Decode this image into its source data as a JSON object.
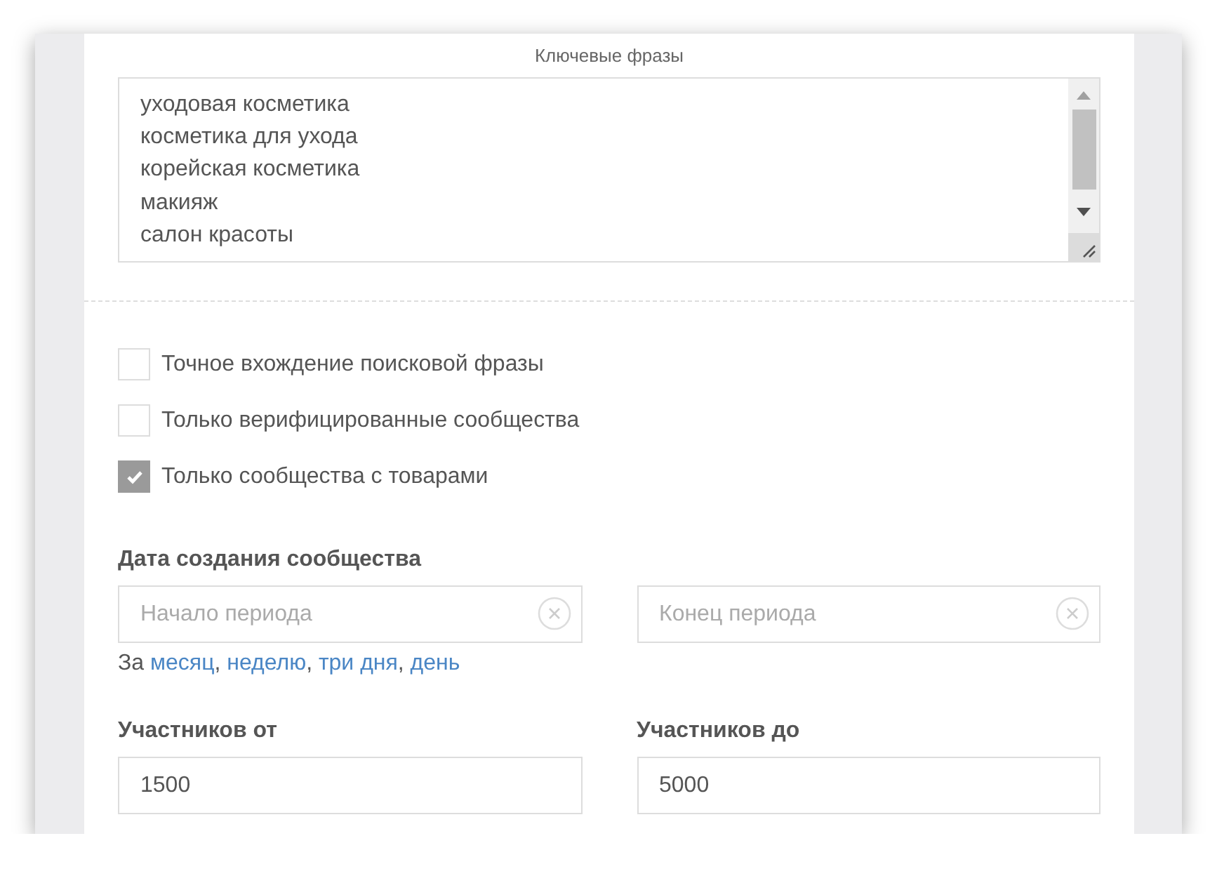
{
  "keywords": {
    "label": "Ключевые фразы",
    "lines": [
      "уходовая косметика",
      "косметика для ухода",
      "корейская косметика",
      "макияж",
      "салон красоты"
    ]
  },
  "filters": [
    {
      "label": "Точное вхождение поисковой фразы",
      "checked": false
    },
    {
      "label": "Только верифицированные сообщества",
      "checked": false
    },
    {
      "label": "Только сообщества с товарами",
      "checked": true
    }
  ],
  "creation_date": {
    "label": "Дата создания сообщества",
    "from": {
      "placeholder": "Начало периода"
    },
    "to": {
      "placeholder": "Конец периода"
    },
    "shortcuts": {
      "prefix": "За",
      "separator": ",",
      "links": [
        "месяц",
        "неделю",
        "три дня",
        "день"
      ]
    }
  },
  "members": [
    {
      "label": "Участников от",
      "value": "1500"
    },
    {
      "label": "Участников до",
      "value": "5000"
    }
  ]
}
